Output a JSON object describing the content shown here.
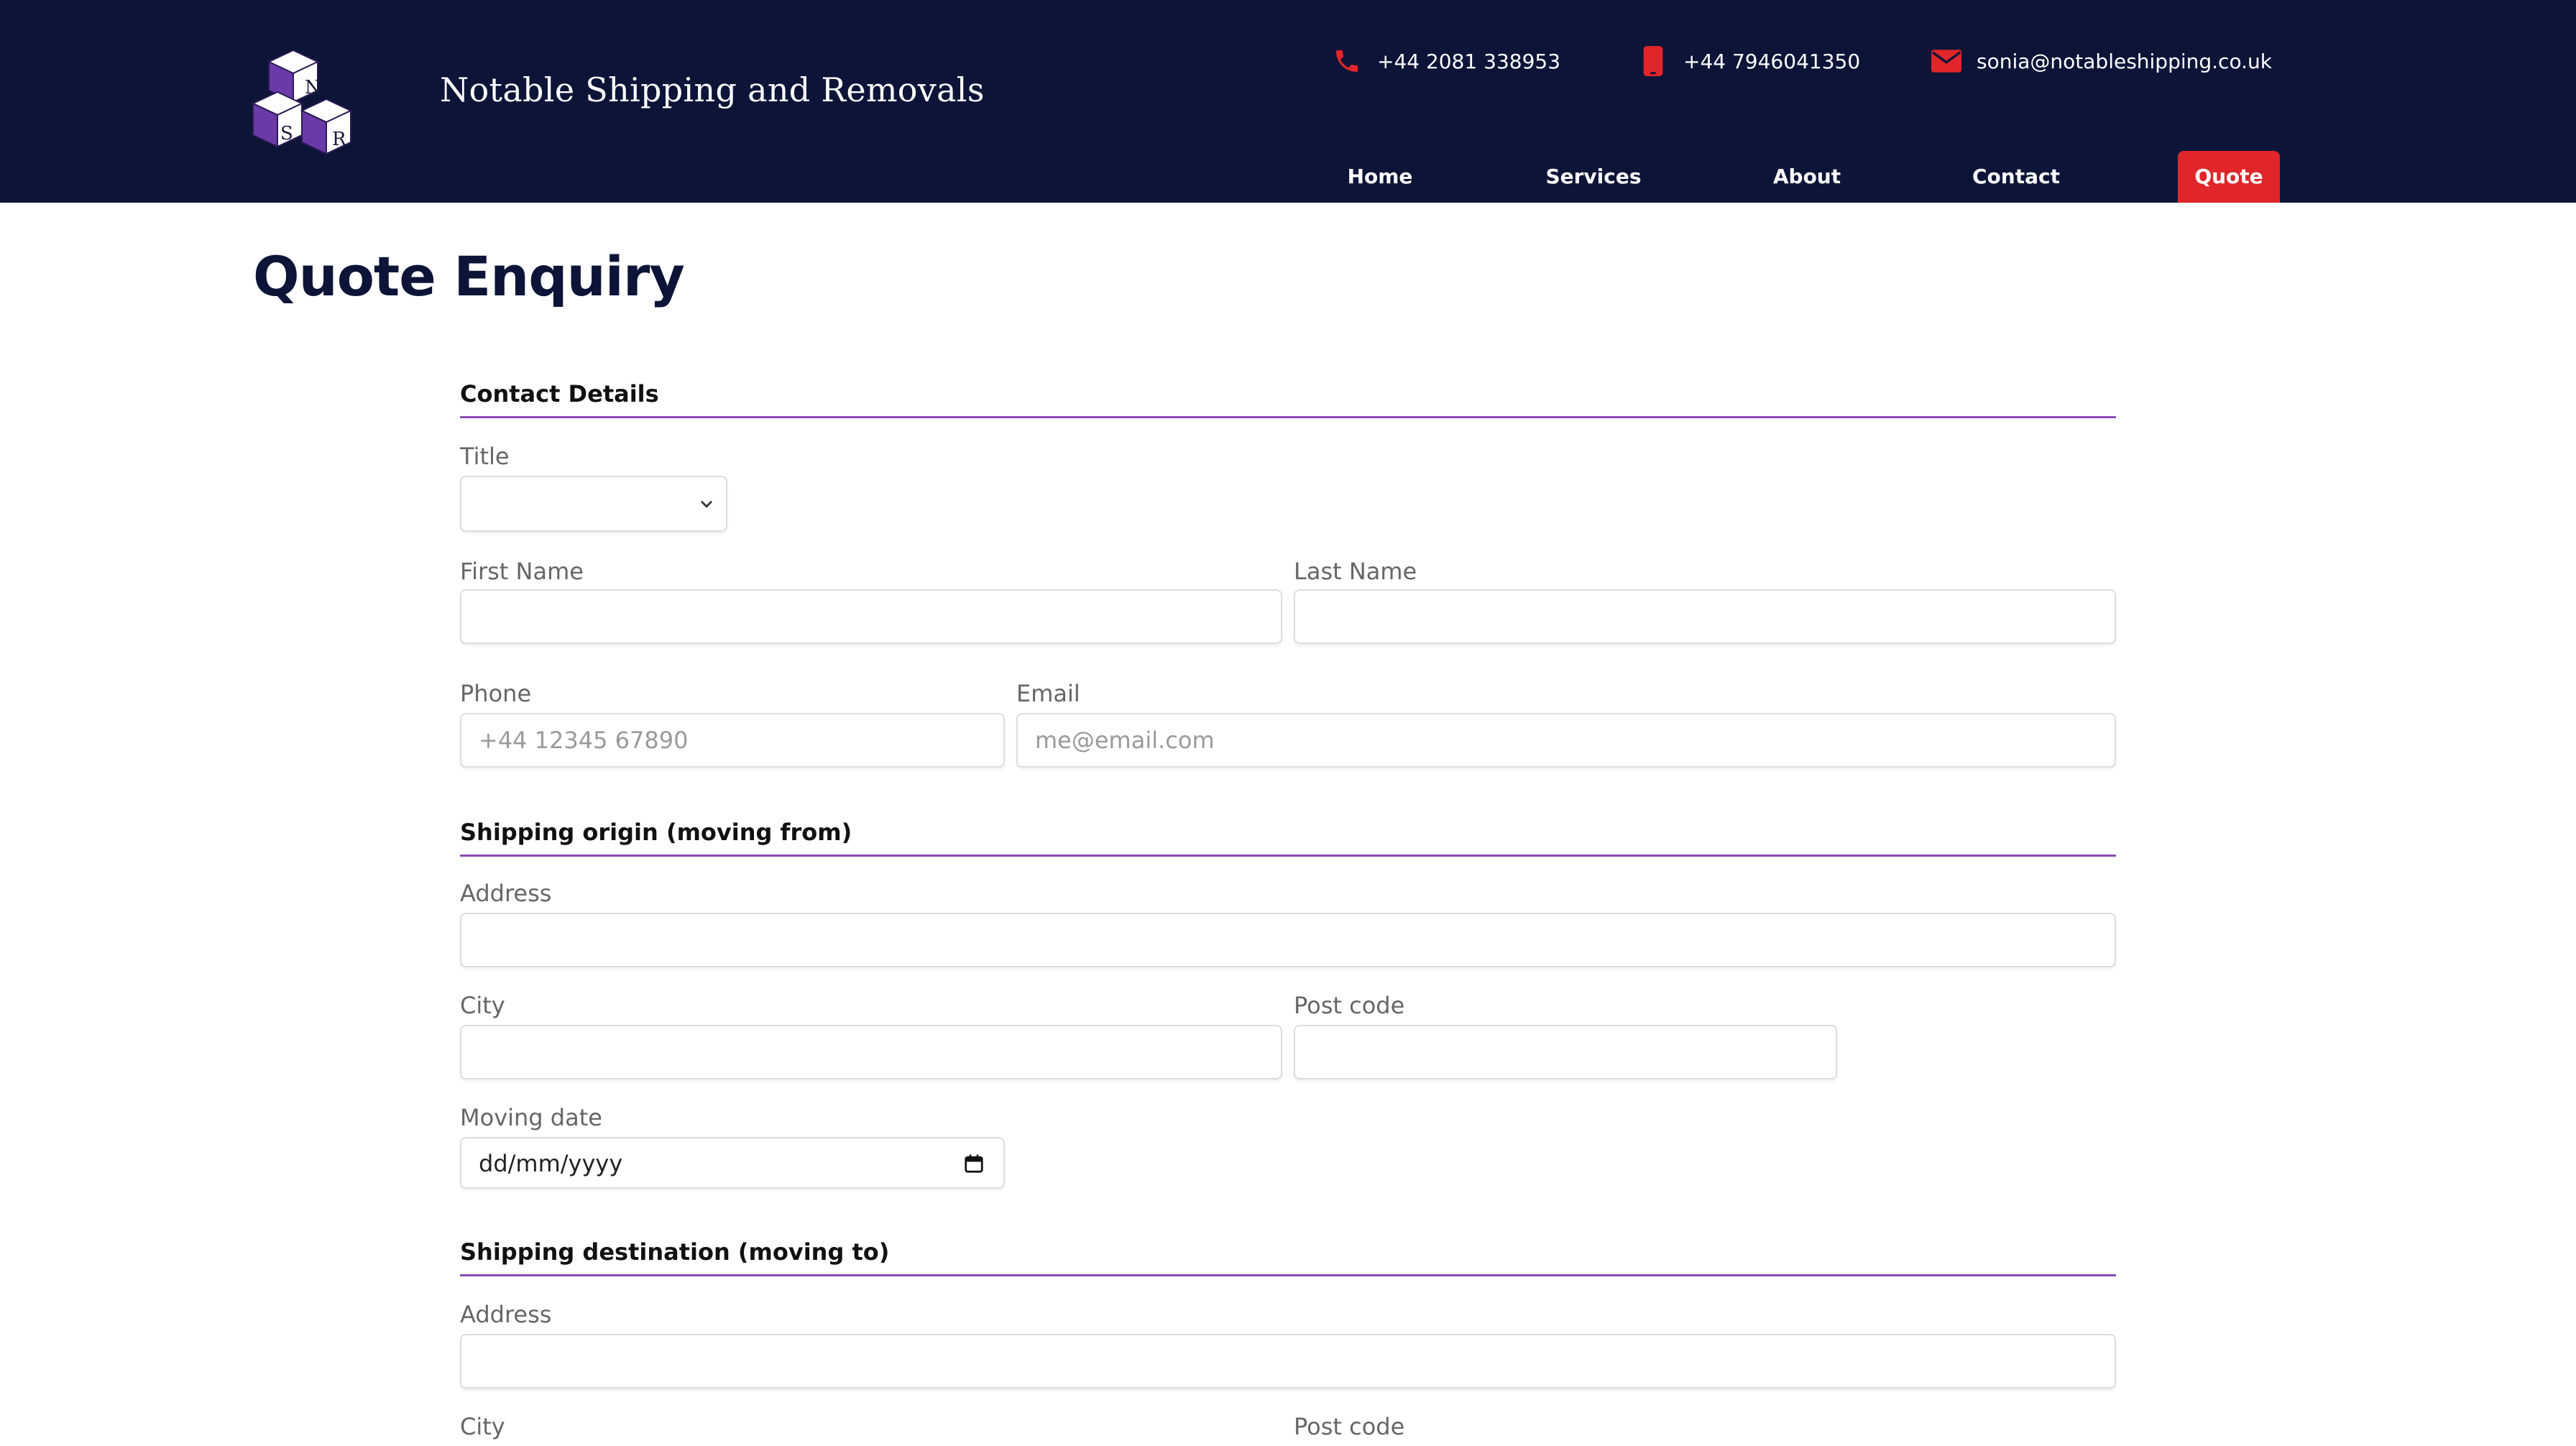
{
  "header": {
    "site_name": "Notable Shipping and Removals",
    "logo_letters": [
      "N",
      "S",
      "R"
    ],
    "phone_landline": "+44 2081 338953",
    "phone_mobile": "+44 7946041350",
    "email": "sonia@notableshipping.co.uk"
  },
  "nav": {
    "home": "Home",
    "services": "Services",
    "about": "About",
    "contact": "Contact",
    "quote": "Quote"
  },
  "page": {
    "title": "Quote Enquiry"
  },
  "contact_details": {
    "heading": "Contact Details",
    "title_label": "Title",
    "title_value": "",
    "first_name_label": "First Name",
    "first_name_value": "",
    "last_name_label": "Last Name",
    "last_name_value": "",
    "phone_label": "Phone",
    "phone_placeholder": "+44 12345 67890",
    "email_label": "Email",
    "email_placeholder": "me@email.com"
  },
  "origin": {
    "heading": "Shipping origin (moving from)",
    "address_label": "Address",
    "city_label": "City",
    "postcode_label": "Post code",
    "moving_date_label": "Moving date",
    "moving_date_value": "dd/mm/yyyy"
  },
  "destination": {
    "heading": "Shipping destination (moving to)",
    "address_label": "Address",
    "city_label": "City",
    "postcode_label": "Post code"
  },
  "colors": {
    "header_bg": "#0c1538",
    "accent_red": "#e0262a",
    "section_rule": "#8b4bb5",
    "logo_purple": "#6a3aa8"
  },
  "icons": {
    "phone": "phone-icon",
    "mobile": "mobile-phone-icon",
    "email": "envelope-icon",
    "select": "chevron-down-icon",
    "date": "calendar-icon"
  }
}
